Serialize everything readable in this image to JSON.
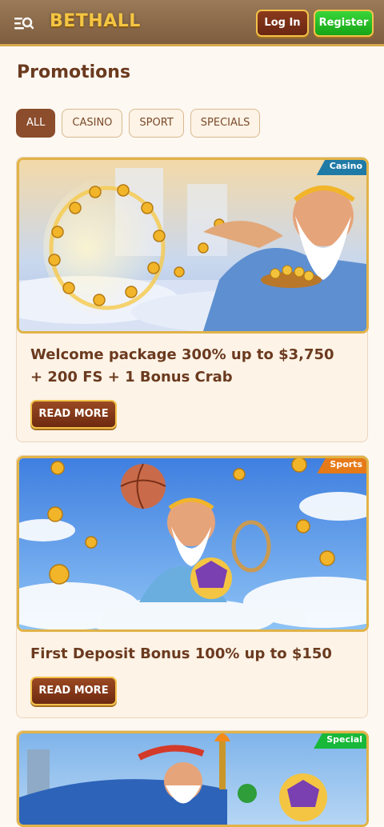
{
  "header": {
    "logo": "BETHALL",
    "login_label": "Log In",
    "register_label": "Register",
    "menu_icon": "menu-search-icon"
  },
  "page": {
    "title": "Promotions"
  },
  "filters": [
    {
      "label": "ALL",
      "active": true
    },
    {
      "label": "CASINO",
      "active": false
    },
    {
      "label": "SPORT",
      "active": false
    },
    {
      "label": "SPECIALS",
      "active": false
    }
  ],
  "promos": [
    {
      "tag": "Casino",
      "tag_color": "#1f7aa6",
      "title_line1": "Welcome package 300% up to $3,750",
      "title_line2": "+ 200 FS + 1 Bonus Crab",
      "button": "READ MORE"
    },
    {
      "tag": "Sports",
      "tag_color": "#e67a18",
      "title_line1": "First Deposit Bonus 100% up to $150",
      "button": "READ MORE"
    },
    {
      "tag": "Special",
      "tag_color": "#18b83a"
    }
  ]
}
